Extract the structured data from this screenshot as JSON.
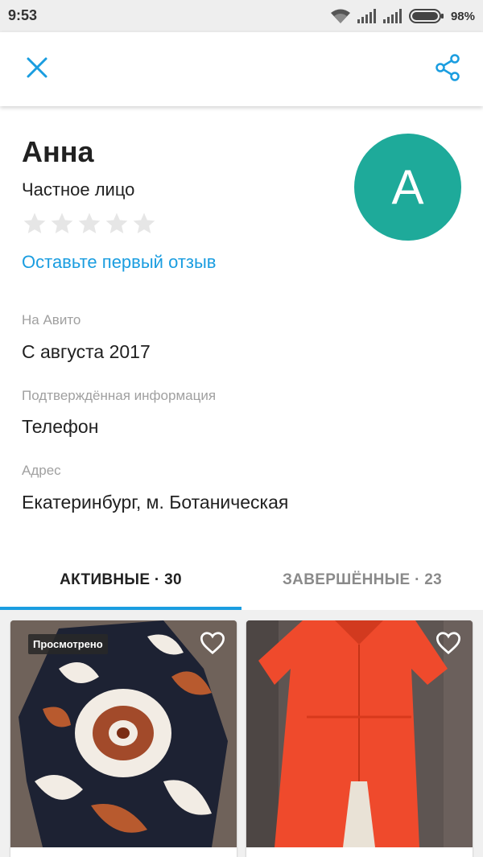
{
  "status_bar": {
    "time": "9:53",
    "battery_percent": "98%",
    "icons": [
      "wifi-icon",
      "signal-icon",
      "signal-icon",
      "battery-icon"
    ]
  },
  "toolbar": {
    "close_icon": "close-icon",
    "share_icon": "share-icon"
  },
  "profile": {
    "name": "Анна",
    "type": "Частное лицо",
    "rating_stars": 0,
    "rating_max": 5,
    "review_link": "Оставьте первый отзыв",
    "avatar_letter": "A"
  },
  "info": [
    {
      "label": "На Авито",
      "value": "С августа 2017"
    },
    {
      "label": "Подтверждённая информация",
      "value": "Телефон"
    },
    {
      "label": "Адрес",
      "value": "Екатеринбург, м. Ботаническая"
    }
  ],
  "tabs": [
    {
      "label": "АКТИВНЫЕ · 30",
      "active": true
    },
    {
      "label": "ЗАВЕРШЁННЫЕ · 23",
      "active": false
    }
  ],
  "listings": [
    {
      "badge": "Просмотрено",
      "favorite_icon": "heart-outline-icon"
    },
    {
      "badge": "",
      "favorite_icon": "heart-outline-icon"
    }
  ],
  "colors": {
    "accent": "#1a9de0",
    "avatar": "#1eaa9a",
    "star_empty": "#e6e6e6",
    "label_gray": "#a0a0a0"
  }
}
